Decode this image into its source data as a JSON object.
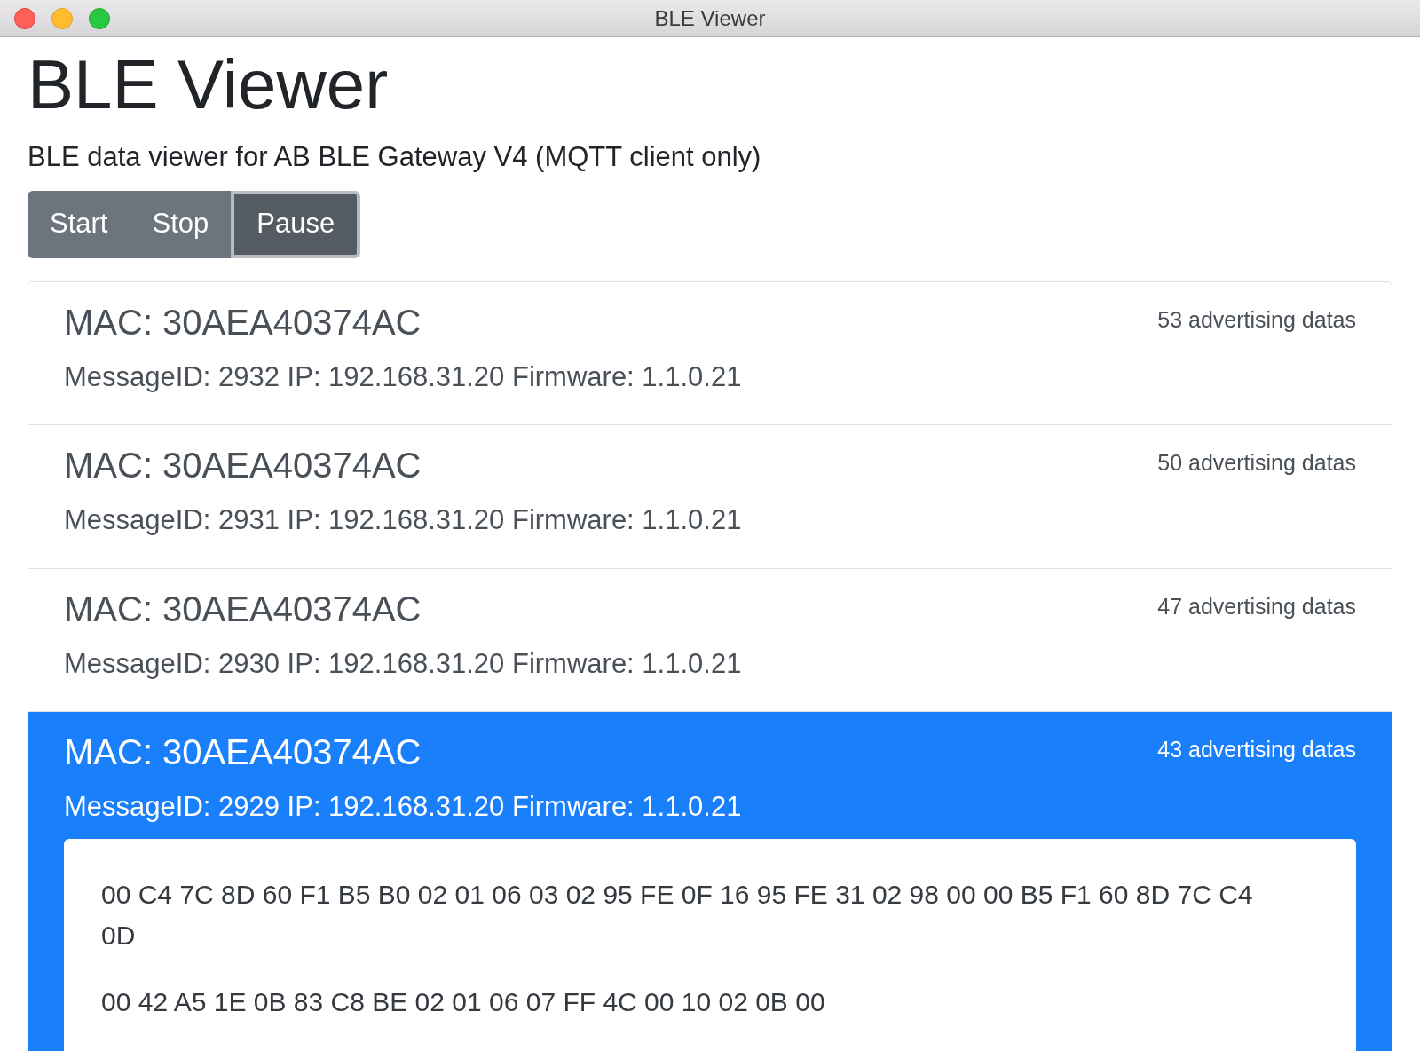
{
  "window": {
    "title": "BLE Viewer"
  },
  "heading": "BLE Viewer",
  "subtitle": "BLE data viewer for AB BLE Gateway V4 (MQTT client only)",
  "buttons": [
    {
      "label": "Start",
      "selected": false
    },
    {
      "label": "Stop",
      "selected": false
    },
    {
      "label": "Pause",
      "selected": true
    }
  ],
  "messages": [
    {
      "mac": "MAC: 30AEA40374AC",
      "details": "MessageID: 2932 IP: 192.168.31.20 Firmware: 1.1.0.21",
      "count": "53 advertising datas",
      "selected": false
    },
    {
      "mac": "MAC: 30AEA40374AC",
      "details": "MessageID: 2931 IP: 192.168.31.20 Firmware: 1.1.0.21",
      "count": "50 advertising datas",
      "selected": false
    },
    {
      "mac": "MAC: 30AEA40374AC",
      "details": "MessageID: 2930 IP: 192.168.31.20 Firmware: 1.1.0.21",
      "count": "47 advertising datas",
      "selected": false
    },
    {
      "mac": "MAC: 30AEA40374AC",
      "details": "MessageID: 2929 IP: 192.168.31.20 Firmware: 1.1.0.21",
      "count": "43 advertising datas",
      "selected": true,
      "advertising_data": [
        "00 C4 7C 8D 60 F1 B5 B0 02 01 06 03 02 95 FE 0F 16 95 FE 31 02 98 00 00 B5 F1 60 8D 7C C4 0D",
        "00 42 A5 1E 0B 83 C8 BE 02 01 06 07 FF 4C 00 10 02 0B 00"
      ]
    }
  ]
}
